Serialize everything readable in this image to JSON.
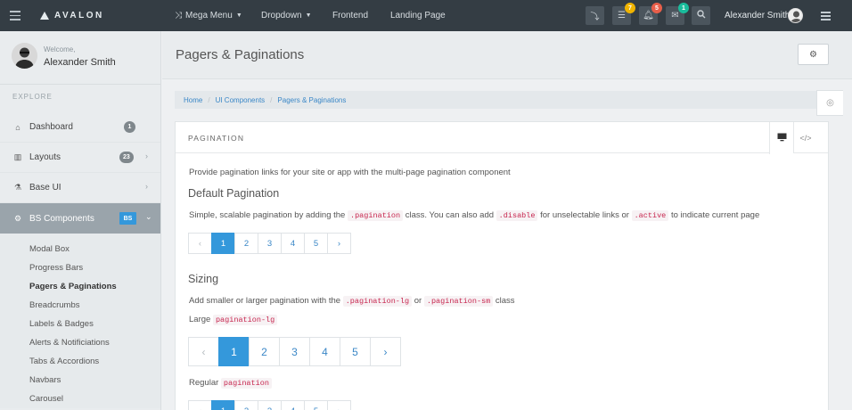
{
  "topbar": {
    "brand": "AVALON",
    "nav": [
      {
        "label": "Mega Menu",
        "has_caret": true,
        "icon": "shuffle-icon"
      },
      {
        "label": "Dropdown",
        "has_caret": true
      },
      {
        "label": "Frontend",
        "has_caret": false
      },
      {
        "label": "Landing Page",
        "has_caret": false
      }
    ],
    "buttons": [
      {
        "icon": "level-down-icon",
        "badge": ""
      },
      {
        "icon": "list-icon",
        "badge": "7",
        "badge_color": "#f0b400"
      },
      {
        "icon": "bell-icon",
        "badge": "5",
        "badge_color": "#e85f4a"
      },
      {
        "icon": "envelope-icon",
        "badge": "1",
        "badge_color": "#1abc9c"
      },
      {
        "icon": "search-icon",
        "badge": ""
      }
    ],
    "user_name": "Alexander Smith"
  },
  "sidebar": {
    "welcome": "Welcome,",
    "user_name": "Alexander Smith",
    "section": "EXPLORE",
    "items": [
      {
        "label": "Dashboard",
        "icon": "home-icon",
        "count": "1",
        "chevron": false
      },
      {
        "label": "Layouts",
        "icon": "columns-icon",
        "count": "23",
        "chevron": true
      },
      {
        "label": "Base UI",
        "icon": "flask-icon",
        "count": "",
        "chevron": true
      },
      {
        "label": "BS Components",
        "icon": "cogs-icon",
        "badge": "BS",
        "chevron": true,
        "active": true
      }
    ],
    "sub_items": [
      "Modal Box",
      "Progress Bars",
      "Pagers & Paginations",
      "Breadcrumbs",
      "Labels & Badges",
      "Alerts & Notificiations",
      "Tabs & Accordions",
      "Navbars",
      "Carousel"
    ],
    "current_sub": "Pagers & Paginations"
  },
  "page": {
    "title": "Pagers & Paginations",
    "breadcrumb": [
      "Home",
      "UI Components",
      "Pagers & Paginations"
    ]
  },
  "panel": {
    "title": "PAGINATION",
    "intro": "Provide pagination links for your site or app with the multi-page pagination component",
    "default": {
      "heading": "Default Pagination",
      "text_1": "Simple, scalable pagination by adding the",
      "code_1": ".pagination",
      "text_2": "class. You can also add",
      "code_2": ".disable",
      "text_3": "for unselectable links or",
      "code_3": ".active",
      "text_4": "to indicate current page"
    },
    "sizing": {
      "heading": "Sizing",
      "text_1": "Add smaller or larger pagination with the",
      "code_1": ".pagination-lg",
      "text_2": "or",
      "code_2": ".pagination-sm",
      "text_3": "class",
      "large_label": "Large",
      "large_code": "pagination-lg",
      "regular_label": "Regular",
      "regular_code": "pagination"
    },
    "pages": [
      "‹",
      "1",
      "2",
      "3",
      "4",
      "5",
      "›"
    ],
    "active_page": "1"
  }
}
